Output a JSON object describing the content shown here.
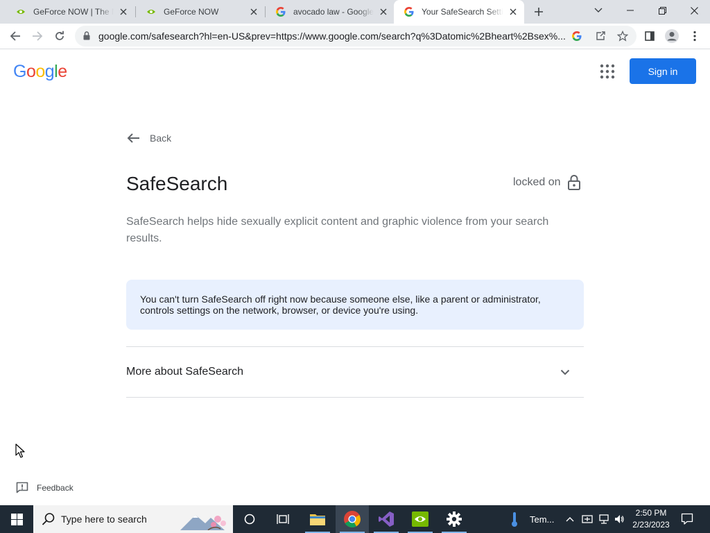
{
  "browser": {
    "tabs": [
      {
        "title": "GeForce NOW | The Ne",
        "favicon": "nvidia-icon"
      },
      {
        "title": "GeForce NOW",
        "favicon": "nvidia-icon"
      },
      {
        "title": "avocado law - Google",
        "favicon": "google-icon"
      },
      {
        "title": "Your SafeSearch Settin",
        "favicon": "google-icon",
        "active": true
      }
    ],
    "url": "google.com/safesearch?hl=en-US&prev=https://www.google.com/search?q%3Datomic%2Bheart%2Bsex%..."
  },
  "header": {
    "logo": [
      "G",
      "o",
      "o",
      "g",
      "l",
      "e"
    ],
    "logo_colors": [
      "#4285f4",
      "#ea4335",
      "#fbbc05",
      "#4285f4",
      "#34a853",
      "#ea4335"
    ],
    "signin_label": "Sign in"
  },
  "main": {
    "back_label": "Back",
    "title": "SafeSearch",
    "lock_status": "locked on",
    "description": "SafeSearch helps hide sexually explicit content and graphic violence from your search results.",
    "notice": "You can't turn SafeSearch off right now because someone else, like a parent or administrator, controls settings on the network, browser, or device you're using.",
    "more_label": "More about SafeSearch"
  },
  "feedback_label": "Feedback",
  "taskbar": {
    "search_placeholder": "Type here to search",
    "weather_label": "Tem...",
    "time": "2:50 PM",
    "date": "2/23/2023"
  },
  "colors": {
    "accent": "#1a73e8",
    "notice_bg": "#e8f0fe",
    "taskbar_bg": "#1f2a35"
  }
}
